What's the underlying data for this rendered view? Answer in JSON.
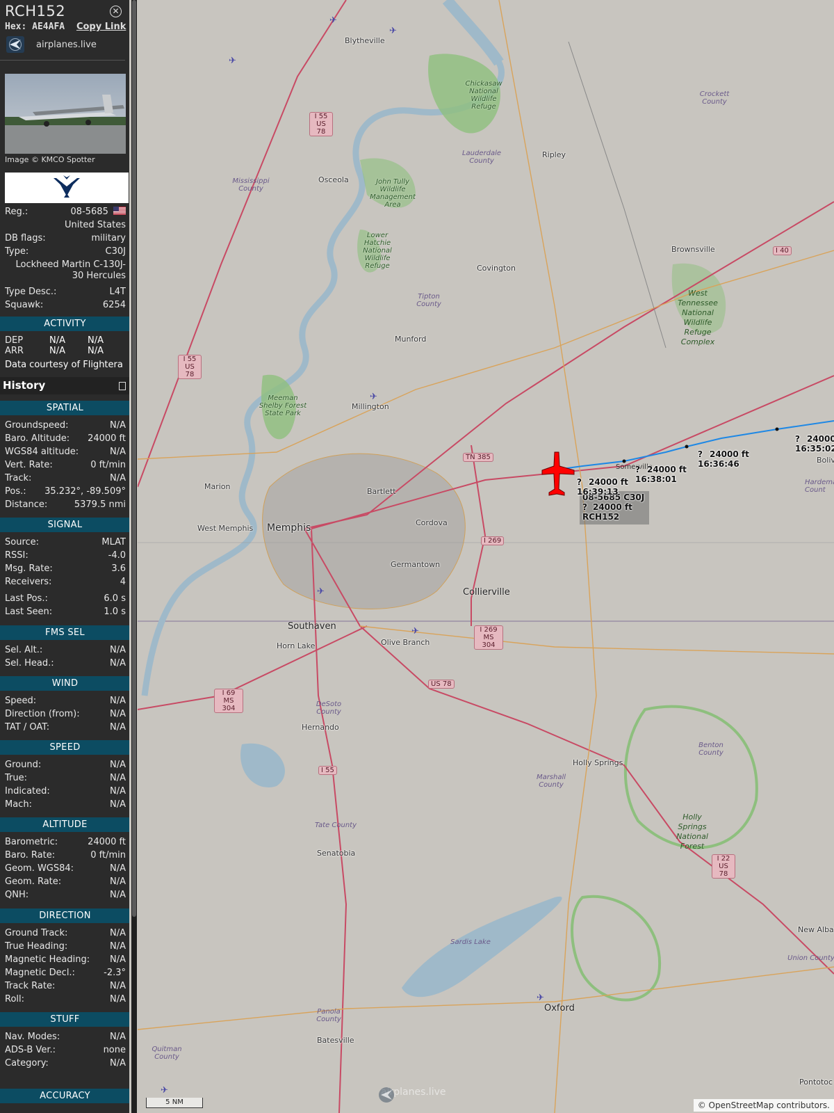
{
  "aircraft": {
    "callsign": "RCH152",
    "hex_label": "Hex:",
    "hex": "AE4AFA",
    "copy_link": "Copy Link",
    "site": "airplanes.live",
    "photo_credit": "Image © KMCO Spotter"
  },
  "details": [
    {
      "key": "Reg.:",
      "value": "08-5685"
    },
    {
      "key": "",
      "value": "United States"
    },
    {
      "key": "DB flags:",
      "value": "military"
    },
    {
      "key": "Type:",
      "value": "C30J"
    },
    {
      "key": "",
      "value": "Lockheed Martin C-130J-30 Hercules"
    },
    {
      "key": "Type Desc.:",
      "value": "L4T"
    },
    {
      "key": "Squawk:",
      "value": "6254"
    }
  ],
  "activity": {
    "title": "ACTIVITY",
    "dep_label": "DEP",
    "dep1": "N/A",
    "dep2": "N/A",
    "arr_label": "ARR",
    "arr1": "N/A",
    "arr2": "N/A",
    "courtesy_prefix": "Data courtesy of",
    "courtesy_source": "Flightera"
  },
  "history_label": "History",
  "sections": {
    "spatial": {
      "title": "SPATIAL",
      "rows": [
        {
          "key": "Groundspeed:",
          "value": "N/A"
        },
        {
          "key": "Baro. Altitude:",
          "value": "24000 ft"
        },
        {
          "key": "WGS84 altitude:",
          "value": "N/A"
        },
        {
          "key": "Vert. Rate:",
          "value": "0 ft/min"
        },
        {
          "key": "Track:",
          "value": "N/A"
        },
        {
          "key": "Pos.:",
          "value": "35.232°, -89.509°"
        },
        {
          "key": "Distance:",
          "value": "5379.5 nmi"
        }
      ]
    },
    "signal": {
      "title": "SIGNAL",
      "rows": [
        {
          "key": "Source:",
          "value": "MLAT"
        },
        {
          "key": "RSSI:",
          "value": "-4.0"
        },
        {
          "key": "Msg. Rate:",
          "value": "3.6"
        },
        {
          "key": "Receivers:",
          "value": "4"
        },
        {
          "key": "Last Pos.:",
          "value": "6.0 s"
        },
        {
          "key": "Last Seen:",
          "value": "1.0 s"
        }
      ]
    },
    "fms": {
      "title": "FMS SEL",
      "rows": [
        {
          "key": "Sel. Alt.:",
          "value": "N/A"
        },
        {
          "key": "Sel. Head.:",
          "value": "N/A"
        }
      ]
    },
    "wind": {
      "title": "WIND",
      "rows": [
        {
          "key": "Speed:",
          "value": "N/A"
        },
        {
          "key": "Direction (from):",
          "value": "N/A"
        },
        {
          "key": "TAT / OAT:",
          "value": "N/A"
        }
      ]
    },
    "speed": {
      "title": "SPEED",
      "rows": [
        {
          "key": "Ground:",
          "value": "N/A"
        },
        {
          "key": "True:",
          "value": "N/A"
        },
        {
          "key": "Indicated:",
          "value": "N/A"
        },
        {
          "key": "Mach:",
          "value": "N/A"
        }
      ]
    },
    "altitude": {
      "title": "ALTITUDE",
      "rows": [
        {
          "key": "Barometric:",
          "value": "24000 ft"
        },
        {
          "key": "Baro. Rate:",
          "value": "0 ft/min"
        },
        {
          "key": "Geom. WGS84:",
          "value": "N/A"
        },
        {
          "key": "Geom. Rate:",
          "value": "N/A"
        },
        {
          "key": "QNH:",
          "value": "N/A"
        }
      ]
    },
    "direction": {
      "title": "DIRECTION",
      "rows": [
        {
          "key": "Ground Track:",
          "value": "N/A"
        },
        {
          "key": "True Heading:",
          "value": "N/A"
        },
        {
          "key": "Magnetic Heading:",
          "value": "N/A"
        },
        {
          "key": "Magnetic Decl.:",
          "value": "-2.3°"
        },
        {
          "key": "Track Rate:",
          "value": "N/A"
        },
        {
          "key": "Roll:",
          "value": "N/A"
        }
      ]
    },
    "stuff": {
      "title": "STUFF",
      "rows": [
        {
          "key": "Nav. Modes:",
          "value": "N/A"
        },
        {
          "key": "ADS-B Ver.:",
          "value": "none"
        },
        {
          "key": "Category:",
          "value": "N/A"
        }
      ]
    },
    "accuracy": {
      "title": "ACCURACY",
      "rows": []
    }
  },
  "map": {
    "places": {
      "blytheville": "Blytheville",
      "osceola": "Osceola",
      "ripley": "Ripley",
      "covington": "Covington",
      "brownsville": "Brownsville",
      "munford": "Munford",
      "millington": "Millington",
      "marion": "Marion",
      "west_memphis": "West Memphis",
      "memphis": "Memphis",
      "bartlett": "Bartlett",
      "cordova": "Cordova",
      "germantown": "Germantown",
      "collierville": "Collierville",
      "southaven": "Southaven",
      "horn_lake": "Horn Lake",
      "olive_branch": "Olive Branch",
      "hernando": "Hernando",
      "holly_springs": "Holly Springs",
      "senatobia": "Senatobia",
      "oxford": "Oxford",
      "batesville": "Batesville",
      "new_albany": "New Albany",
      "pontotoc": "Pontotoc",
      "bolivar": "Boliva",
      "somerville": "Somerville"
    },
    "counties": {
      "mississippi": "Mississippi County",
      "lauderdale": "Lauderdale County",
      "crockett": "Crockett County",
      "tipton": "Tipton County",
      "marshall": "Marshall County",
      "benton": "Benton County",
      "desoto": "DeSoto County",
      "tate": "Tate County",
      "panola": "Panola County",
      "quitman": "Quitman County",
      "union": "Union County",
      "lafayette": "Sardis Lake",
      "hardeman": "Hardeman Count"
    },
    "parks": {
      "chickasaw": "Chickasaw National Wildlife Refuge",
      "john_tully": "John Tully Wildlife Management Area",
      "lower_hatchie": "Lower Hatchie National Wildlife Refuge",
      "meeman": "Meeman Shelby Forest State Park",
      "west_tn": "West Tennessee National Wildlife Refuge Complex",
      "holly_forest": "Holly Springs National Forest"
    },
    "shields": {
      "i55_us78_n": "I 55 US 78",
      "i55_us78_w": "I 55 US 78",
      "i40": "I 40",
      "tn385": "TN 385",
      "i269": "I 269",
      "i269_ms304": "I 269 MS 304",
      "us78": "US 78",
      "i69_ms304": "I 69 MS 304",
      "i55_s": "I 55",
      "i22_us78": "I 22 US 78"
    },
    "track_labels": [
      {
        "alt": "24000 ft",
        "time": "16:39:13"
      },
      {
        "alt": "24000 ft",
        "time": "16:38:01"
      },
      {
        "alt": "24000 ft",
        "time": "16:36:46"
      },
      {
        "alt": "24000",
        "time": "16:35:02"
      }
    ],
    "track_unknown": "?",
    "plane_label": {
      "line1": "08-5685 C30J",
      "alt": "24000 ft",
      "callsign": "RCH152",
      "unknown": "?"
    },
    "scale": "5 NM",
    "watermark": "airplanes.live",
    "attribution_prefix": "©",
    "attribution_link": "OpenStreetMap",
    "attribution_suffix": "contributors.",
    "colors": {
      "track": "#1e88e5",
      "aircraft": "#ff0000",
      "river": "#9fb9c9",
      "park": "#8ebf7e",
      "road_major": "#c84a64",
      "road_minor": "#d9a35a"
    }
  }
}
